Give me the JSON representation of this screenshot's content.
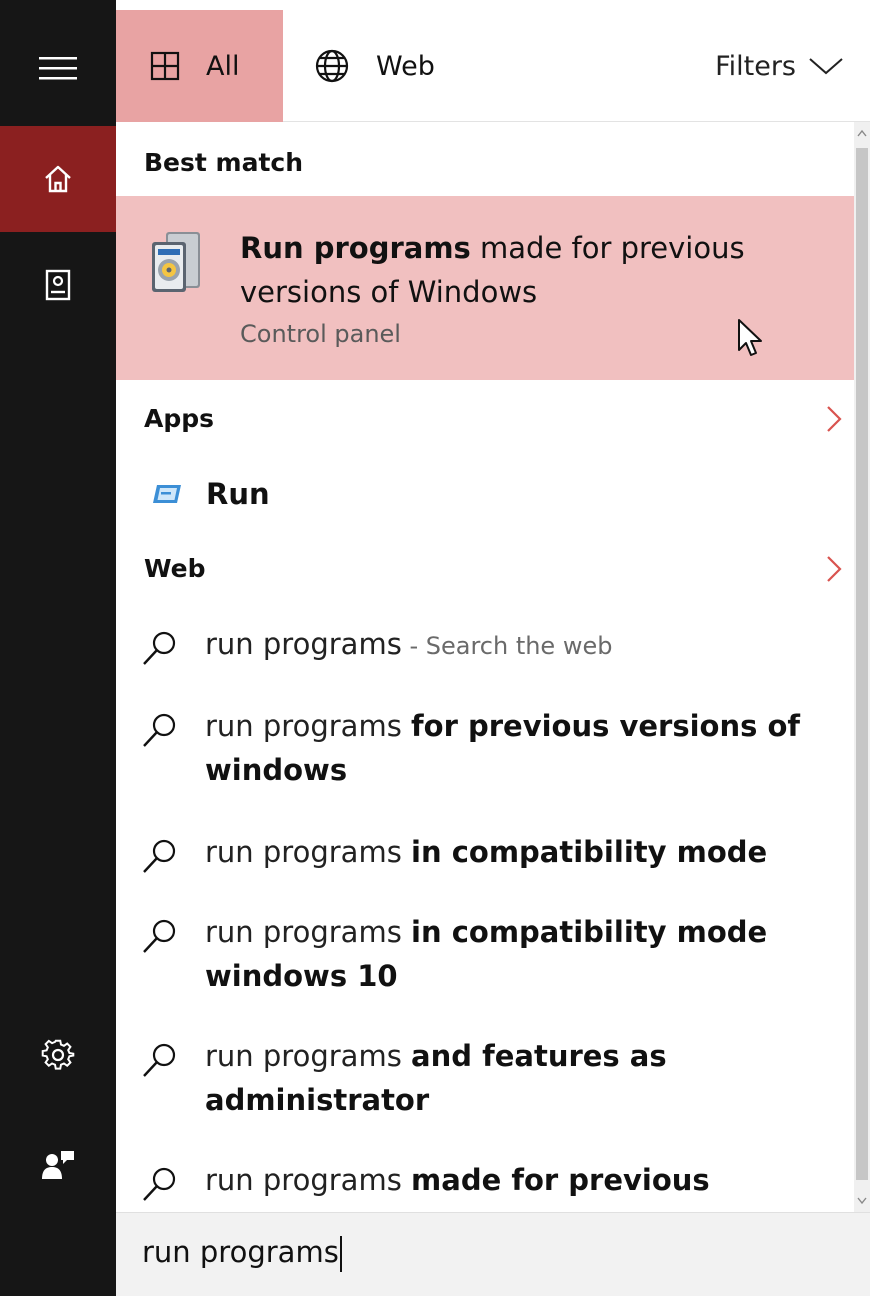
{
  "tabs": {
    "all_label": "All",
    "web_label": "Web"
  },
  "filters_label": "Filters",
  "best_match": {
    "header": "Best match",
    "title_bold": "Run programs",
    "title_rest": " made for previous versions of Windows",
    "subtitle": "Control panel"
  },
  "apps": {
    "header": "Apps",
    "items": [
      {
        "name": "Run"
      }
    ]
  },
  "web": {
    "header": "Web",
    "suggestions": [
      {
        "prefix": "run programs",
        "bold": "",
        "hint": " - Search the web"
      },
      {
        "prefix": "run programs ",
        "bold": "for previous versions of windows",
        "hint": ""
      },
      {
        "prefix": "run programs ",
        "bold": "in compatibility mode",
        "hint": ""
      },
      {
        "prefix": "run programs ",
        "bold": "in compatibility mode windows 10",
        "hint": ""
      },
      {
        "prefix": "run programs ",
        "bold": "and features as administrator",
        "hint": ""
      },
      {
        "prefix": "run programs ",
        "bold": "made for previous",
        "hint": ""
      }
    ]
  },
  "search": {
    "query": "run programs"
  },
  "colors": {
    "accent": "#8b2020",
    "selected_tab": "#e8a3a3",
    "highlight": "#f1c0c0",
    "rail": "#161616",
    "chevron": "#d9534f"
  },
  "icons": {
    "menu": "hamburger-menu-icon",
    "home": "home-icon",
    "notebook": "notebook-icon",
    "settings": "gear-icon",
    "feedback": "feedback-icon",
    "all": "grid-icon",
    "web": "globe-icon",
    "search": "magnifier-icon"
  }
}
